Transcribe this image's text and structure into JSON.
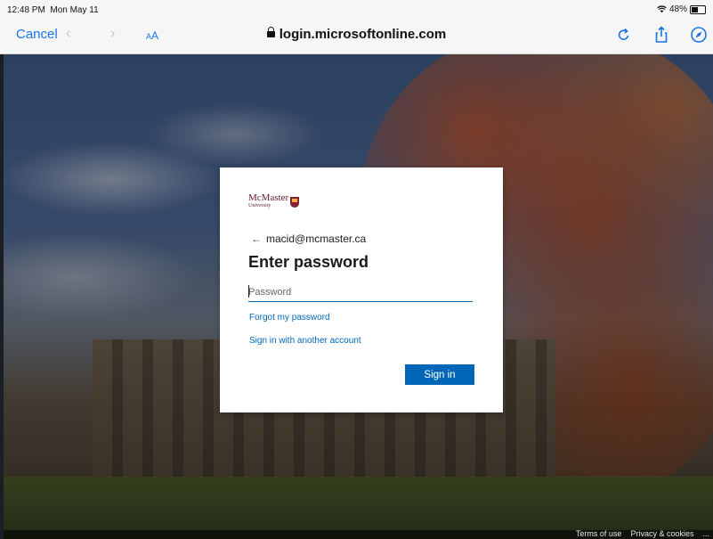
{
  "status_bar": {
    "time": "12:48 PM",
    "date": "Mon May 11",
    "wifi_icon": "wifi-icon",
    "battery": "48%",
    "battery_level": 0.48
  },
  "browser": {
    "cancel_label": "Cancel",
    "back_icon": "chevron-left-icon",
    "forward_icon": "chevron-right-icon",
    "text_size_label": "AA",
    "url": "login.microsoftonline.com",
    "lock_icon": "lock-icon",
    "reload_icon": "reload-icon",
    "share_icon": "share-icon",
    "compass_icon": "compass-icon",
    "accent": "#1a73e8"
  },
  "signin": {
    "logo_name": "McMaster",
    "logo_subname": "University",
    "back_icon": "arrow-left-icon",
    "identity": "macid@mcmaster.ca",
    "title": "Enter password",
    "password_placeholder": "Password",
    "password_value": "",
    "forgot_password": "Forgot my password",
    "another_account": "Sign in with another account",
    "submit_label": "Sign in",
    "accent": "#0067b8"
  },
  "footer": {
    "terms": "Terms of use",
    "privacy": "Privacy & cookies",
    "more": "..."
  }
}
